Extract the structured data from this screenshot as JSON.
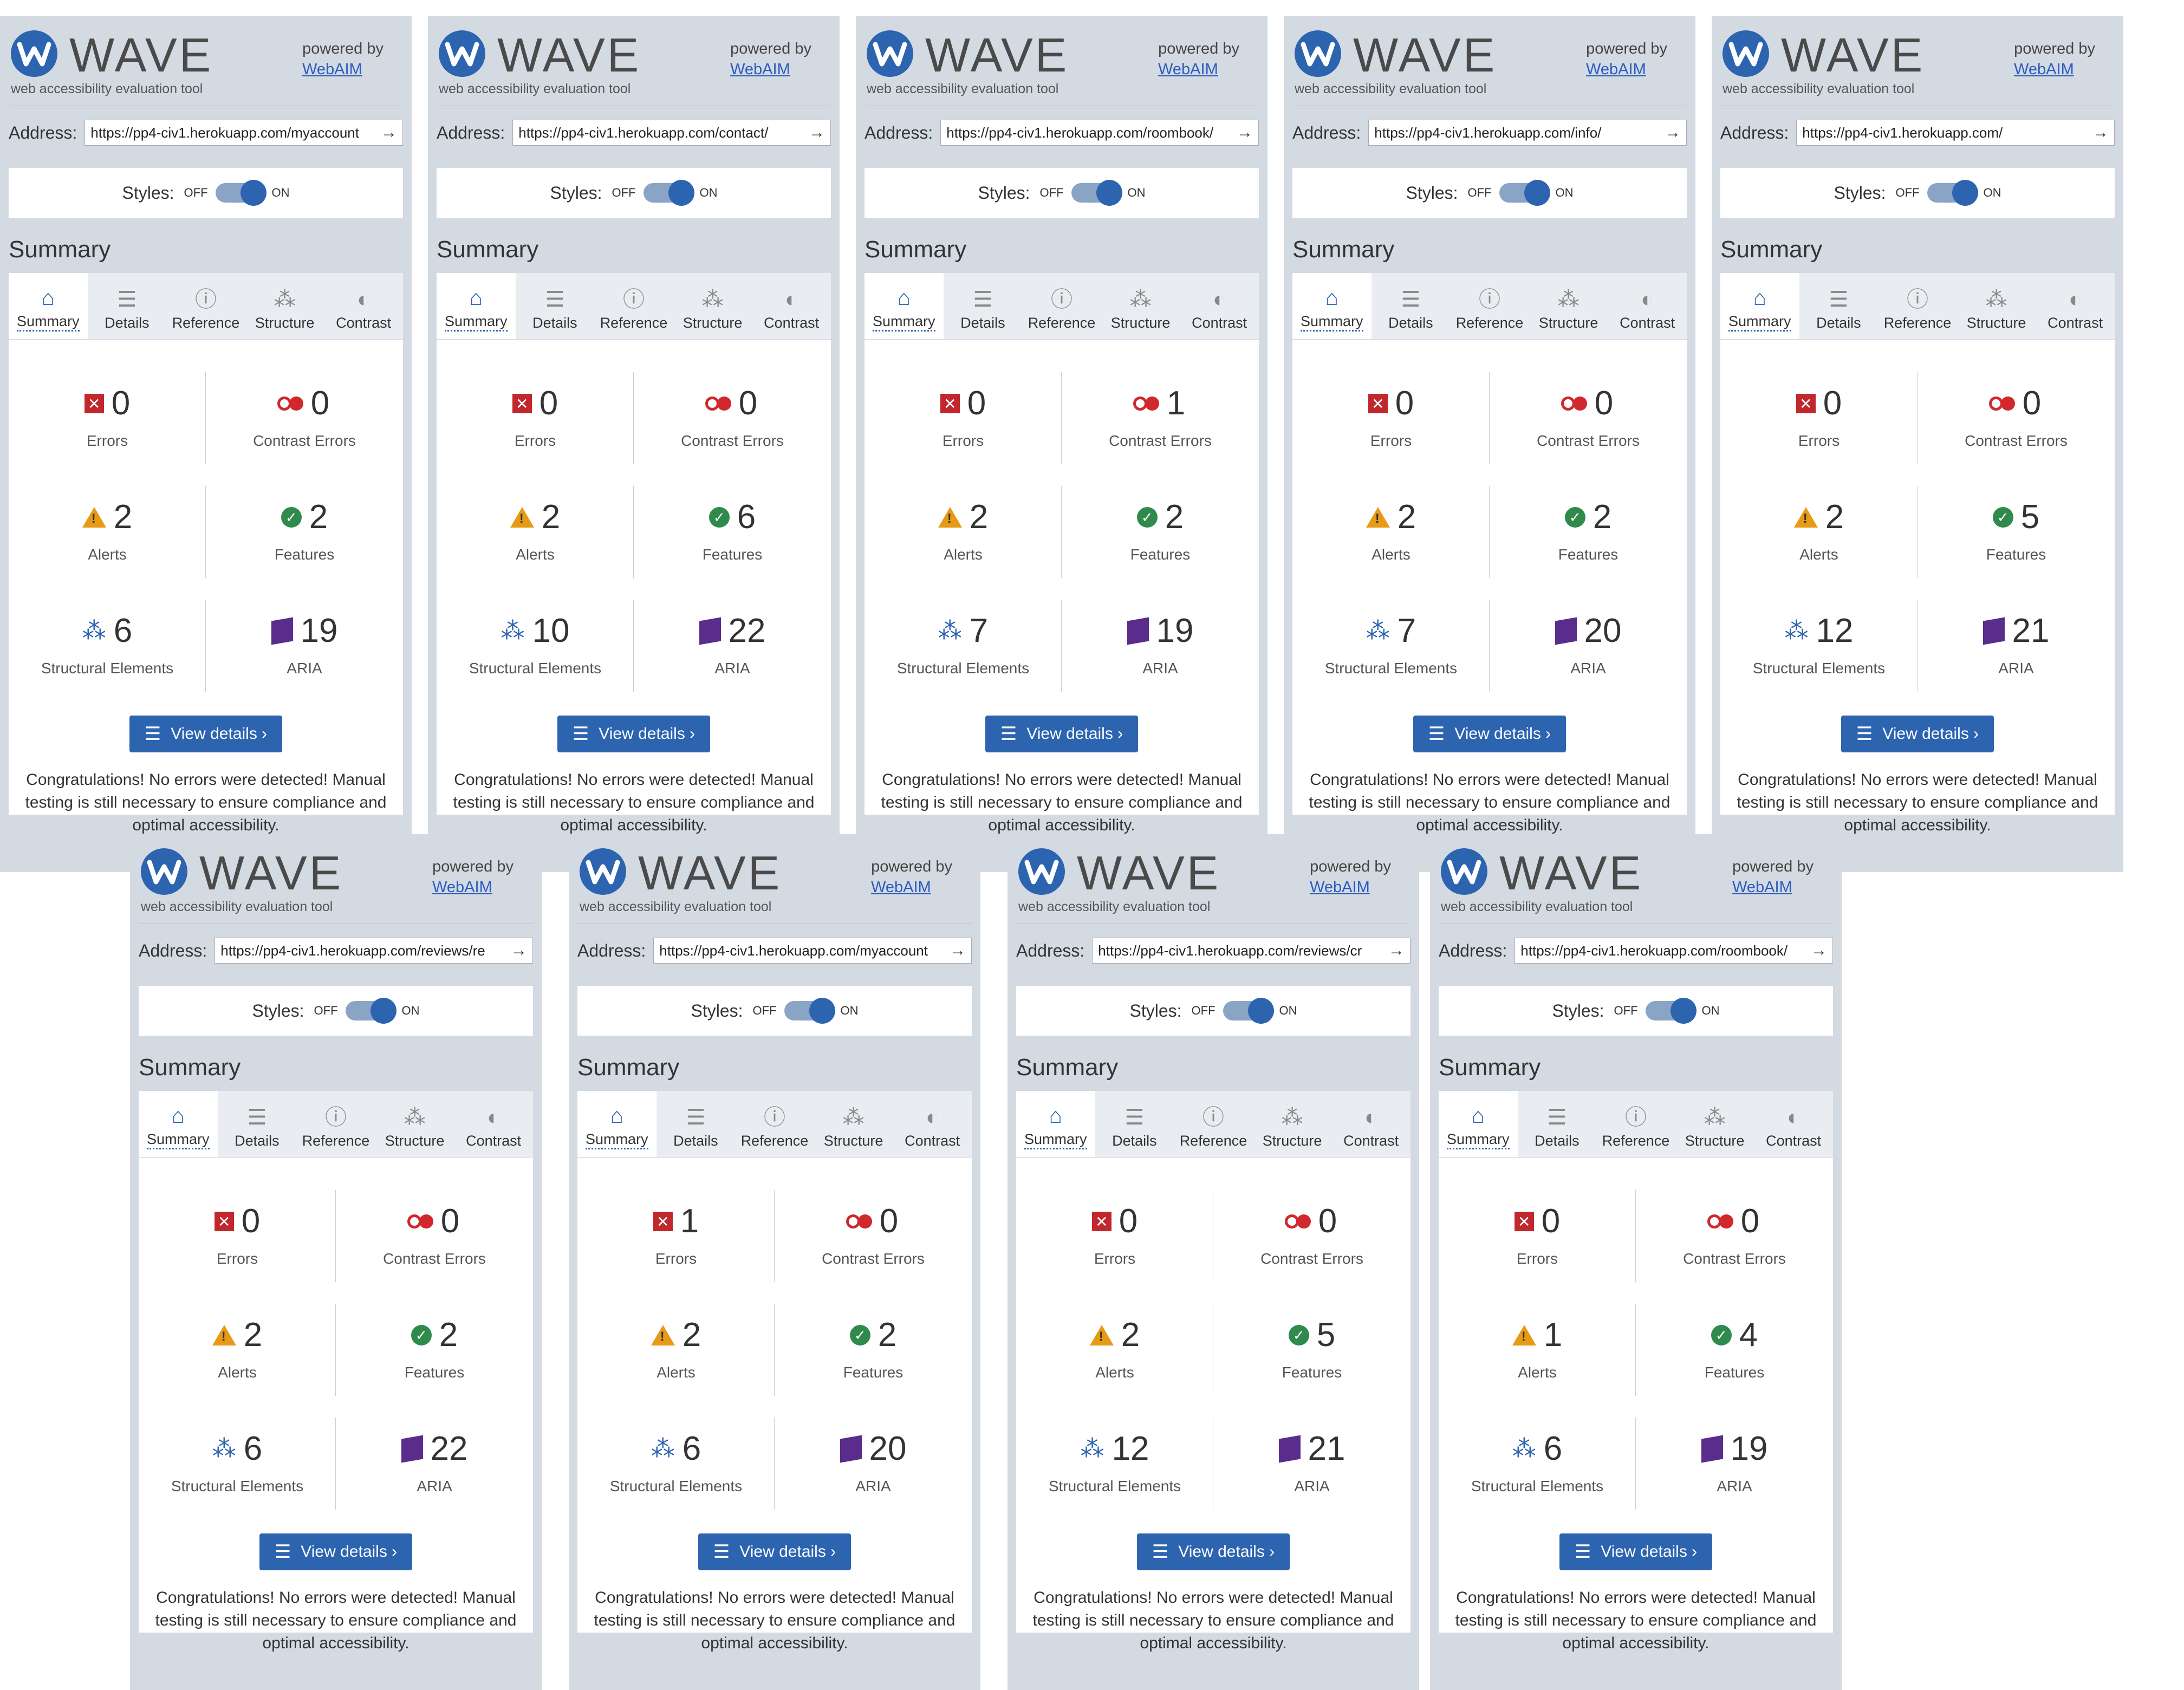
{
  "brand": {
    "title": "WAVE",
    "subtitle": "web accessibility evaluation tool",
    "powered_by": "powered by",
    "webaim": "WebAIM",
    "logo_color": "#2c64b0"
  },
  "ui": {
    "address_label": "Address:",
    "styles_label": "Styles:",
    "off": "OFF",
    "on": "ON",
    "summary_heading": "Summary",
    "view_details": "View details ›",
    "congrats": "Congratulations! No errors were detected! Manual testing is still necessary to ensure compliance and optimal accessibility.",
    "tabs": [
      "Summary",
      "Details",
      "Reference",
      "Structure",
      "Contrast"
    ],
    "labels": {
      "errors": "Errors",
      "contrast": "Contrast Errors",
      "alerts": "Alerts",
      "features": "Features",
      "structural": "Structural Elements",
      "aria": "ARIA"
    }
  },
  "panels": [
    {
      "url": "https://pp4-civ1.herokuapp.com/myaccount",
      "errors": "0",
      "contrast": "0",
      "alerts": "2",
      "features": "2",
      "structural": "6",
      "aria": "19"
    },
    {
      "url": "https://pp4-civ1.herokuapp.com/contact/",
      "errors": "0",
      "contrast": "0",
      "alerts": "2",
      "features": "6",
      "structural": "10",
      "aria": "22"
    },
    {
      "url": "https://pp4-civ1.herokuapp.com/roombook/",
      "errors": "0",
      "contrast": "1",
      "alerts": "2",
      "features": "2",
      "structural": "7",
      "aria": "19"
    },
    {
      "url": "https://pp4-civ1.herokuapp.com/info/",
      "errors": "0",
      "contrast": "0",
      "alerts": "2",
      "features": "2",
      "structural": "7",
      "aria": "20"
    },
    {
      "url": "https://pp4-civ1.herokuapp.com/",
      "errors": "0",
      "contrast": "0",
      "alerts": "2",
      "features": "5",
      "structural": "12",
      "aria": "21"
    },
    {
      "url": "https://pp4-civ1.herokuapp.com/reviews/re",
      "errors": "0",
      "contrast": "0",
      "alerts": "2",
      "features": "2",
      "structural": "6",
      "aria": "22"
    },
    {
      "url": "https://pp4-civ1.herokuapp.com/myaccount",
      "errors": "1",
      "contrast": "0",
      "alerts": "2",
      "features": "2",
      "structural": "6",
      "aria": "20"
    },
    {
      "url": "https://pp4-civ1.herokuapp.com/reviews/cr",
      "errors": "0",
      "contrast": "0",
      "alerts": "2",
      "features": "5",
      "structural": "12",
      "aria": "21"
    },
    {
      "url": "https://pp4-civ1.herokuapp.com/roombook/",
      "errors": "0",
      "contrast": "0",
      "alerts": "1",
      "features": "4",
      "structural": "6",
      "aria": "19"
    }
  ]
}
